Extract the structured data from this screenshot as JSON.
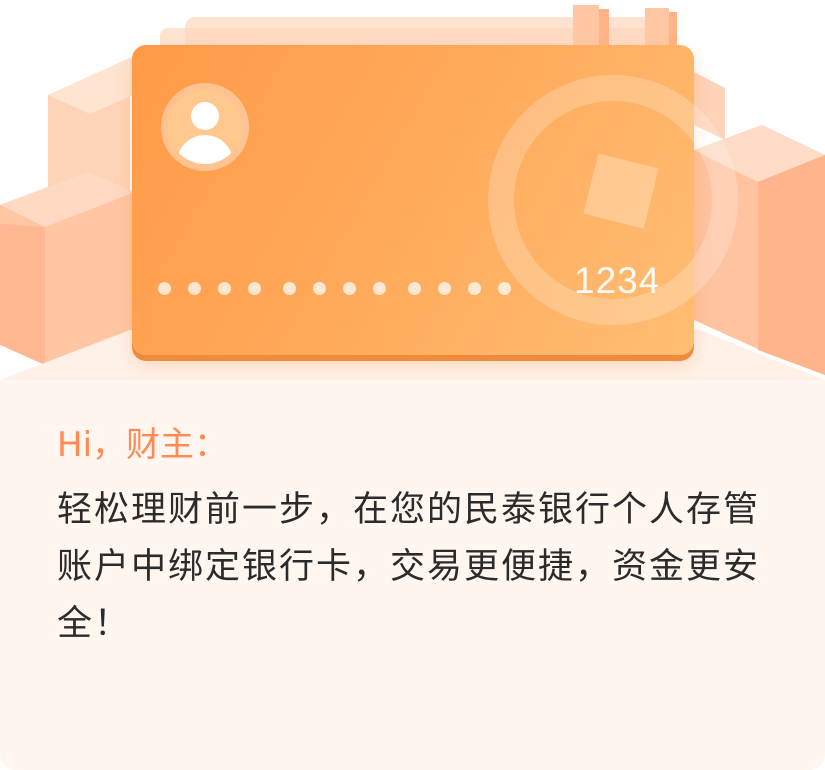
{
  "card": {
    "last_digits": "1234",
    "masked_groups": [
      4,
      4,
      4
    ]
  },
  "message": {
    "greeting": "Hi，财主：",
    "body": "轻松理财前一步，在您的民泰银行个人存管账户中绑定银行卡，交易更便捷，资金更安全！"
  },
  "colors": {
    "card_start": "#ff9a47",
    "card_end": "#ffbe73",
    "greeting": "#ff8a56",
    "body_text": "#2b2b2b",
    "panel_bg": "#fff6f0"
  },
  "icons": {
    "avatar": "user-avatar-icon"
  }
}
